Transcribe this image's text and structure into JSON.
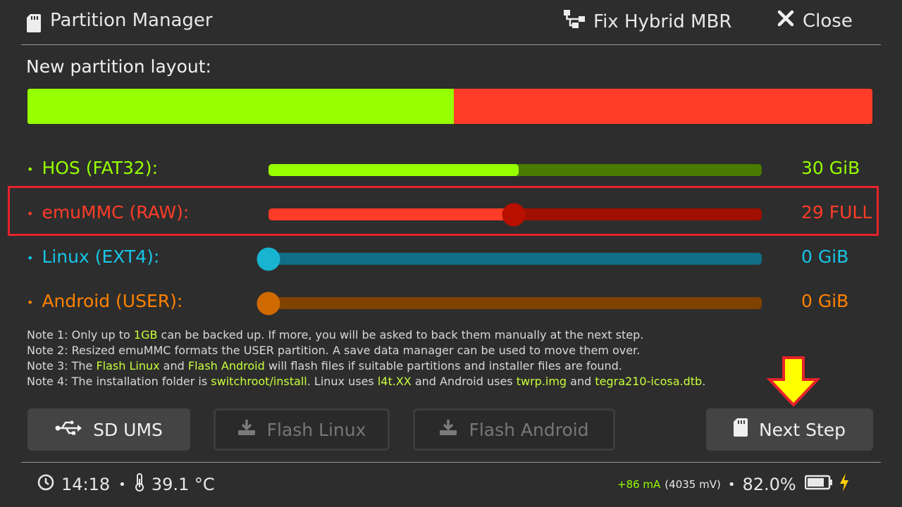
{
  "header": {
    "title": "Partition Manager",
    "fix_mbr_label": "Fix Hybrid MBR",
    "close_label": "Close"
  },
  "layout": {
    "label": "New partition layout:",
    "hos_fraction": 0.505,
    "emu_fraction": 0.495,
    "hos_color": "#96ff00",
    "emu_color": "#ff3c28"
  },
  "partitions": [
    {
      "label": "HOS (FAT32):",
      "value": "30 GiB",
      "color": "#96ff00",
      "track_color": "#4a7a00",
      "level": 0.507,
      "knob": false
    },
    {
      "label": "emuMMC (RAW):",
      "value": "29 FULL",
      "color": "#ff3c28",
      "track_color": "#a00f00",
      "level": 0.497,
      "knob": true,
      "knob_color": "#b80f00"
    },
    {
      "label": "Linux (EXT4):",
      "value": "0 GiB",
      "color": "#18c4e6",
      "track_color": "#106f84",
      "level": 0.0,
      "knob": true,
      "knob_color": "#18b4d2"
    },
    {
      "label": "Android (USER):",
      "value": "0 GiB",
      "color": "#ff8200",
      "track_color": "#804200",
      "level": 0.0,
      "knob": true,
      "knob_color": "#d06a00"
    }
  ],
  "notes": {
    "n1a": "Note 1: Only up to ",
    "n1b": "1GB",
    "n1c": " can be backed up. If more, you will be asked to back them manually at the next step.",
    "n2": "Note 2: Resized emuMMC formats the USER partition. A save data manager can be used to move them over.",
    "n3a": "Note 3: The ",
    "n3b": "Flash Linux",
    "n3c": " and ",
    "n3d": "Flash Android",
    "n3e": " will flash files if suitable partitions and installer files are found.",
    "n4a": "Note 4: The installation folder is ",
    "n4b": "switchroot/install",
    "n4c": ". Linux uses ",
    "n4d": "l4t.XX",
    "n4e": " and Android uses ",
    "n4f": "twrp.img",
    "n4g": " and ",
    "n4h": "tegra210-icosa.dtb",
    "n4i": "."
  },
  "buttons": {
    "sd_ums": "SD UMS",
    "flash_linux": "Flash Linux",
    "flash_android": "Flash Android",
    "next_step": "Next Step"
  },
  "footer": {
    "time": "14:18",
    "temperature": "39.1 °C",
    "current": "+86 mA",
    "voltage": "(4035 mV)",
    "battery": "82.0%",
    "battery_level": 0.82
  }
}
